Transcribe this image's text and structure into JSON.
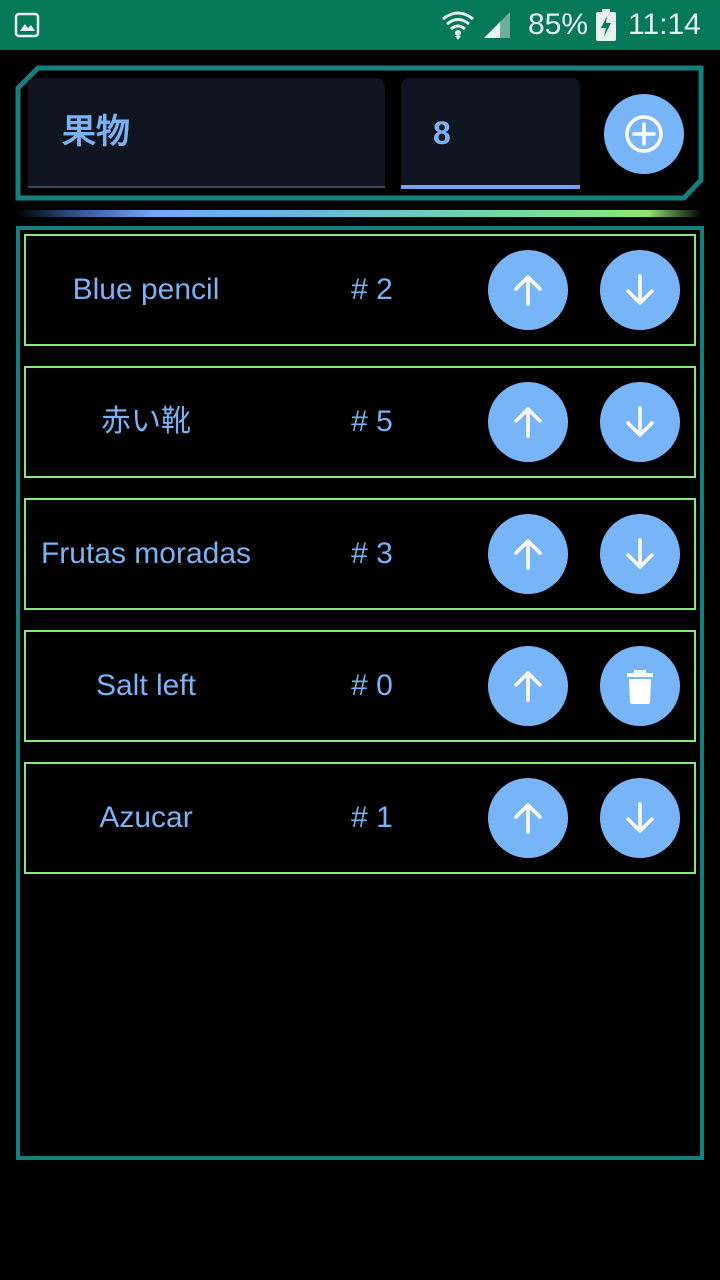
{
  "status_bar": {
    "battery": "85%",
    "time": "11:14",
    "bg_color": "#05785a"
  },
  "form": {
    "name_value": "果物",
    "quantity_value": "8",
    "add_icon": "add-circle-icon"
  },
  "items": [
    {
      "name": "Blue pencil",
      "count": "# 2",
      "up_icon": "arrow-up-icon",
      "second_icon": "arrow-down-icon"
    },
    {
      "name": "赤い靴",
      "count": "# 5",
      "up_icon": "arrow-up-icon",
      "second_icon": "arrow-down-icon"
    },
    {
      "name": "Frutas moradas",
      "count": "# 3",
      "up_icon": "arrow-up-icon",
      "second_icon": "arrow-down-icon"
    },
    {
      "name": "Salt left",
      "count": "# 0",
      "up_icon": "arrow-up-icon",
      "second_icon": "trash-icon"
    },
    {
      "name": "Azucar",
      "count": "# 1",
      "up_icon": "arrow-up-icon",
      "second_icon": "arrow-down-icon"
    }
  ],
  "colors": {
    "accent": "#78b4f8",
    "text": "#7ab3f5",
    "frame": "#167f7d",
    "row_border": "#8ae87a",
    "field_bg": "#0e1520"
  }
}
